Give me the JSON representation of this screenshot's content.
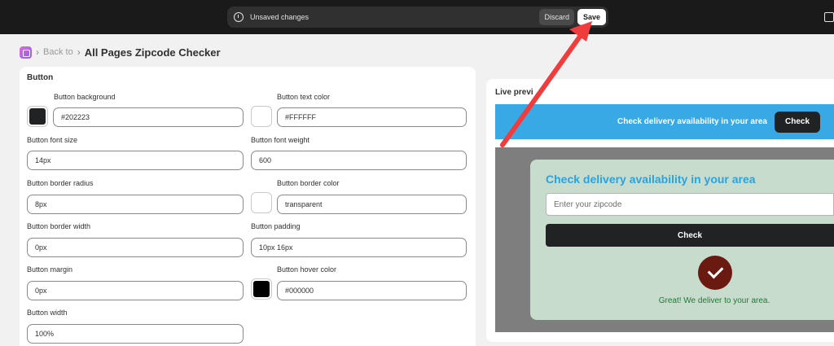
{
  "save_bar": {
    "message": "Unsaved changes",
    "discard_label": "Discard",
    "save_label": "Save"
  },
  "breadcrumb": {
    "back_label": "Back to",
    "title": "All Pages Zipcode Checker"
  },
  "settings": {
    "section_title": "Button",
    "fields": {
      "bg": {
        "label": "Button background",
        "value": "#202223",
        "swatch": "#202223"
      },
      "text_color": {
        "label": "Button text color",
        "value": "#FFFFFF",
        "swatch": "#FFFFFF"
      },
      "font_size": {
        "label": "Button font size",
        "value": "14px"
      },
      "font_weight": {
        "label": "Button font weight",
        "value": "600"
      },
      "border_radius": {
        "label": "Button border radius",
        "value": "8px"
      },
      "border_color": {
        "label": "Button border color",
        "value": "transparent",
        "swatch": "#FFFFFF"
      },
      "border_width": {
        "label": "Button border width",
        "value": "0px"
      },
      "padding": {
        "label": "Button padding",
        "value": "10px 16px"
      },
      "margin": {
        "label": "Button margin",
        "value": "0px"
      },
      "hover_color": {
        "label": "Button hover color",
        "value": "#000000",
        "swatch": "#000000"
      },
      "width": {
        "label": "Button width",
        "value": "100%"
      }
    }
  },
  "preview": {
    "label": "Live previ",
    "banner_text": "Check delivery availability in your area",
    "banner_button": "Check",
    "modal_title": "Check delivery availability in your area",
    "zip_placeholder": "Enter your zipcode",
    "modal_button": "Check",
    "success_message": "Great! We deliver to your area."
  }
}
